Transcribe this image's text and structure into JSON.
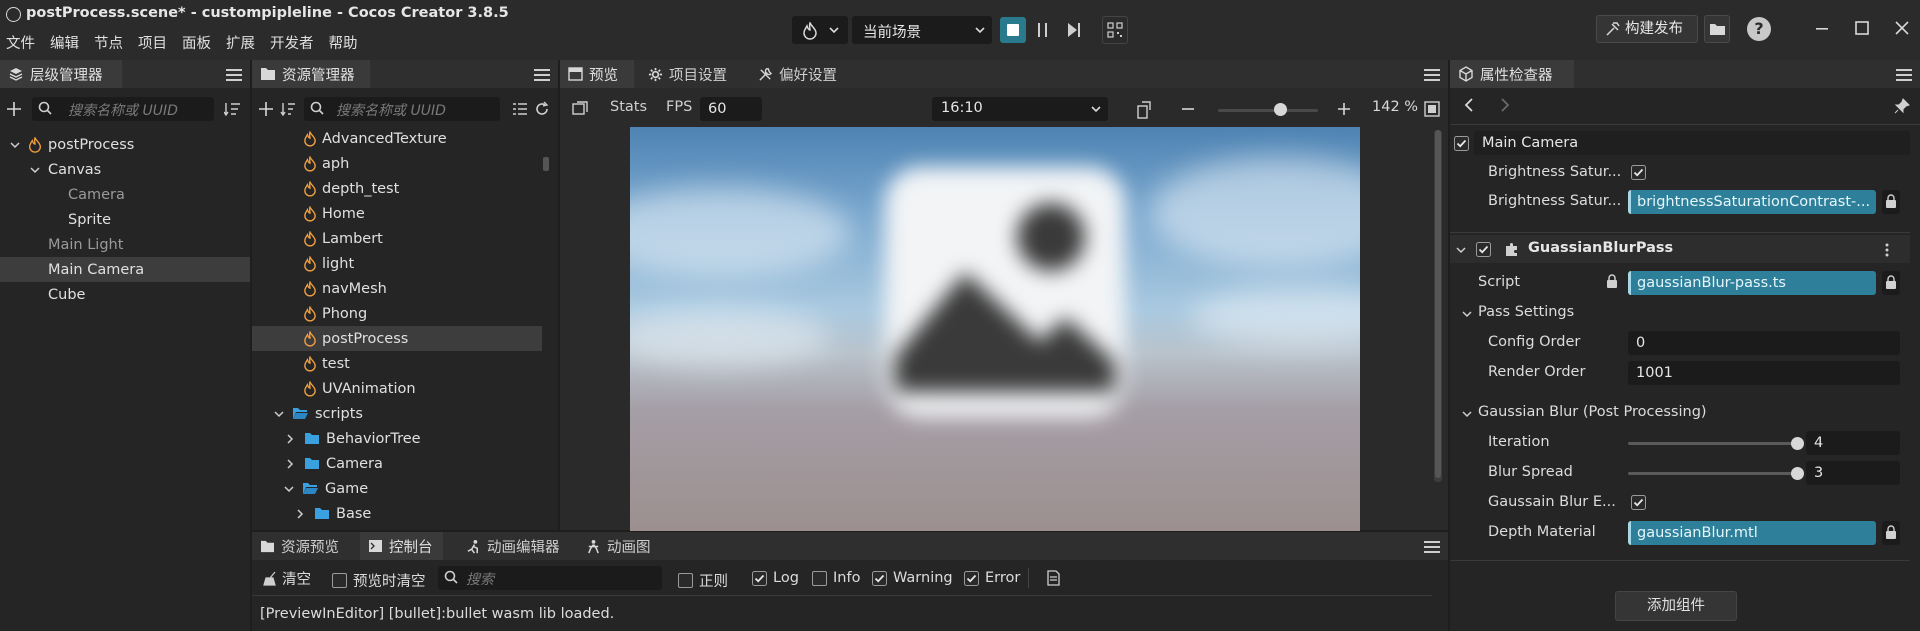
{
  "window": {
    "title": "postProcess.scene* - custompipleline - Cocos Creator 3.8.5",
    "menu": [
      "文件",
      "编辑",
      "节点",
      "项目",
      "面板",
      "扩展",
      "开发者",
      "帮助"
    ]
  },
  "toolbar": {
    "scene_select": "当前场景",
    "build_label": "构建发布"
  },
  "hierarchy": {
    "tab": "层级管理器",
    "search_placeholder": "搜索名称或 UUID",
    "items": [
      {
        "label": "postProcess"
      },
      {
        "label": "Canvas"
      },
      {
        "label": "Camera"
      },
      {
        "label": "Sprite"
      },
      {
        "label": "Main Light"
      },
      {
        "label": "Main Camera"
      },
      {
        "label": "Cube"
      }
    ]
  },
  "assets": {
    "tab": "资源管理器",
    "search_placeholder": "搜索名称或 UUID",
    "items": [
      {
        "label": "AdvancedTexture"
      },
      {
        "label": "aph"
      },
      {
        "label": "depth_test"
      },
      {
        "label": "Home"
      },
      {
        "label": "Lambert"
      },
      {
        "label": "light"
      },
      {
        "label": "navMesh"
      },
      {
        "label": "Phong"
      },
      {
        "label": "postProcess"
      },
      {
        "label": "test"
      },
      {
        "label": "UVAnimation"
      },
      {
        "label": "scripts"
      },
      {
        "label": "BehaviorTree"
      },
      {
        "label": "Camera"
      },
      {
        "label": "Game"
      },
      {
        "label": "Base"
      }
    ]
  },
  "preview": {
    "tabs": [
      "预览",
      "项目设置",
      "偏好设置"
    ],
    "stats_label": "Stats",
    "fps_label": "FPS",
    "fps_value": "60",
    "ratio": "16:10",
    "zoom": "142 %",
    "zoom_level": 0.62
  },
  "console": {
    "tabs": [
      "资源预览",
      "控制台",
      "动画编辑器",
      "动画图"
    ],
    "clear_label": "清空",
    "clear_on_preview_label": "预览时清空",
    "search_placeholder": "搜索",
    "regex_label": "正则",
    "log_label": "Log",
    "info_label": "Info",
    "warning_label": "Warning",
    "error_label": "Error",
    "message": "[PreviewInEditor] [bullet]:bullet wasm lib loaded."
  },
  "inspector": {
    "tab": "属性检查器",
    "node_name": "Main Camera",
    "bsc_enable_label": "Brightness Satur...",
    "bsc_material_label": "Brightness Satur...",
    "bsc_material_value": "brightnessSaturationContrast-...",
    "component_name": "GuassianBlurPass",
    "script_label": "Script",
    "script_value": "gaussianBlur-pass.ts",
    "pass_settings_label": "Pass Settings",
    "config_order_label": "Config Order",
    "config_order_value": "0",
    "render_order_label": "Render Order",
    "render_order_value": "1001",
    "blur_group_label": "Gaussian Blur (Post Processing)",
    "iteration_label": "Iteration",
    "iteration_value": "4",
    "blur_spread_label": "Blur Spread",
    "blur_spread_value": "3",
    "blur_enable_label": "Gaussain Blur E...",
    "depth_material_label": "Depth Material",
    "depth_material_value": "gaussianBlur.mtl",
    "add_component_label": "添加组件"
  }
}
